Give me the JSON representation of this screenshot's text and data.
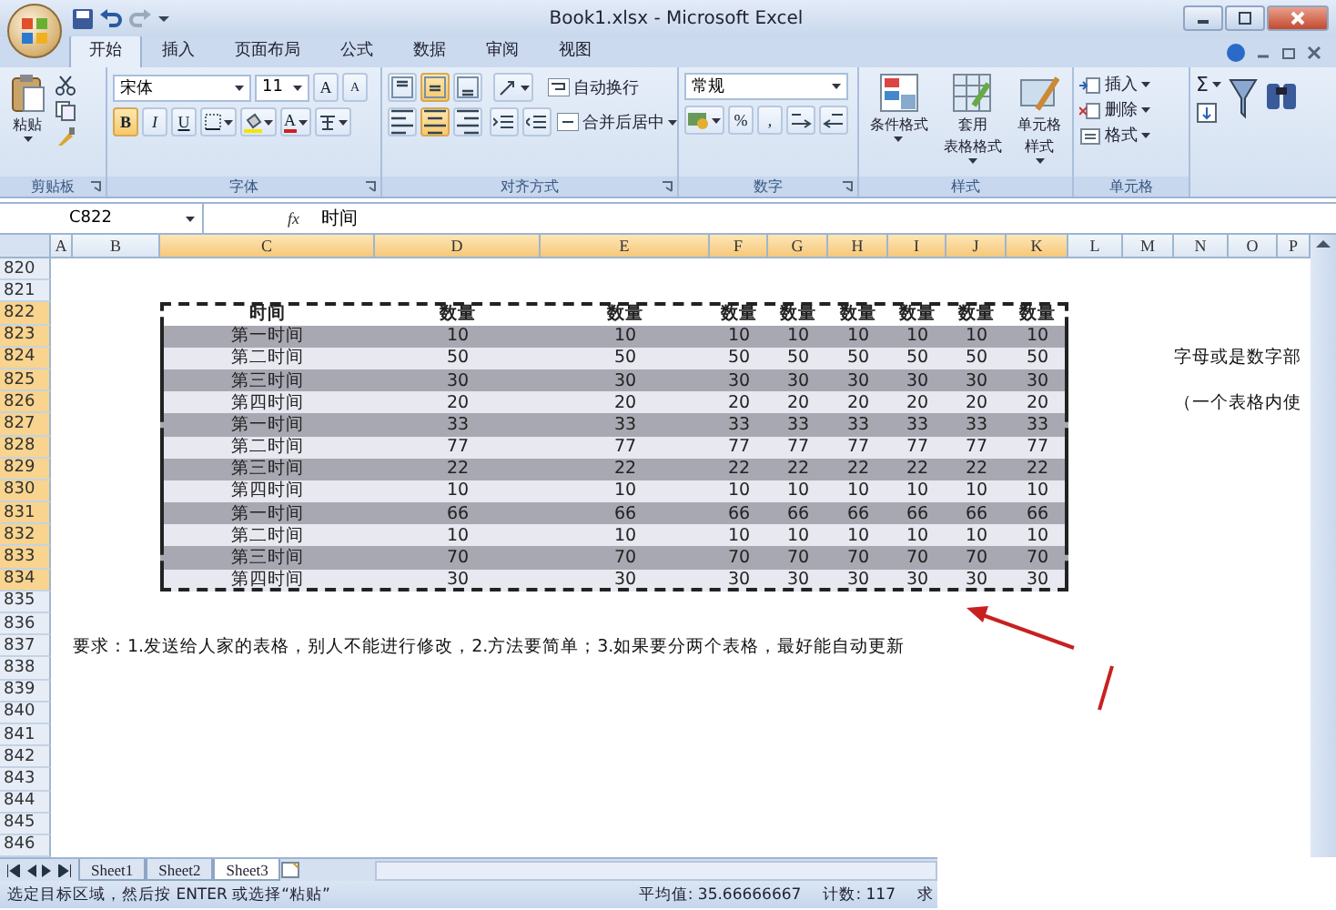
{
  "window": {
    "title": "Book1.xlsx - Microsoft Excel"
  },
  "tabs": [
    {
      "label": "开始",
      "selected": true
    },
    {
      "label": "插入",
      "selected": false
    },
    {
      "label": "页面布局",
      "selected": false
    },
    {
      "label": "公式",
      "selected": false
    },
    {
      "label": "数据",
      "selected": false
    },
    {
      "label": "审阅",
      "selected": false
    },
    {
      "label": "视图",
      "selected": false
    }
  ],
  "ribbon": {
    "clipboard": {
      "label": "剪贴板",
      "launcher": true,
      "paste": "粘贴"
    },
    "font": {
      "label": "字体",
      "launcher": true,
      "font_name": "宋体",
      "font_size": "11",
      "grow": "A",
      "shrink": "A",
      "styles": [
        {
          "label": "B",
          "selected": true
        },
        {
          "label": "I",
          "selected": false
        },
        {
          "label": "U",
          "selected": false
        }
      ],
      "font_color": "A"
    },
    "alignment": {
      "label": "对齐方式",
      "launcher": true,
      "vertical": [
        {
          "selected": false
        },
        {
          "selected": true
        },
        {
          "selected": false
        }
      ],
      "horizontal": [
        {
          "selected": false
        },
        {
          "selected": true
        },
        {
          "selected": false
        }
      ],
      "wrap": "自动换行",
      "merge": "合并后居中"
    },
    "number": {
      "label": "数字",
      "launcher": true,
      "format": "常规",
      "percent": "%",
      "comma": ","
    },
    "styles": {
      "label": "样式",
      "buttons": [
        {
          "kind": "conditional",
          "lines": [
            "条件格式"
          ]
        },
        {
          "kind": "table",
          "lines": [
            "套用",
            "表格格式"
          ]
        },
        {
          "kind": "cell",
          "lines": [
            "单元格",
            "样式"
          ]
        }
      ]
    },
    "cells": {
      "label": "单元格",
      "buttons": [
        {
          "kind": "insert",
          "label": "插入"
        },
        {
          "kind": "delete",
          "label": "删除"
        },
        {
          "kind": "format",
          "label": "格式"
        }
      ]
    },
    "editing": {
      "sum": "Σ"
    }
  },
  "formula_bar": {
    "name_box": "C822",
    "fx": "fx",
    "formula": "时间"
  },
  "sheet": {
    "columns": [
      {
        "label": "A",
        "selected": false
      },
      {
        "label": "B",
        "selected": false
      },
      {
        "label": "C",
        "selected": true
      },
      {
        "label": "D",
        "selected": true
      },
      {
        "label": "E",
        "selected": true
      },
      {
        "label": "F",
        "selected": true
      },
      {
        "label": "G",
        "selected": true
      },
      {
        "label": "H",
        "selected": true
      },
      {
        "label": "I",
        "selected": true
      },
      {
        "label": "J",
        "selected": true
      },
      {
        "label": "K",
        "selected": true
      },
      {
        "label": "L",
        "selected": false
      },
      {
        "label": "M",
        "selected": false
      },
      {
        "label": "N",
        "selected": false
      },
      {
        "label": "O",
        "selected": false
      },
      {
        "label": "P",
        "selected": false
      }
    ],
    "rows": [
      {
        "number": "820",
        "selected": false
      },
      {
        "number": "821",
        "selected": false
      },
      {
        "number": "822",
        "selected": true,
        "kind": "header",
        "cells": [
          "时间",
          "数量",
          "数量",
          "数量",
          "数量",
          "数量",
          "数量",
          "数量",
          "数量"
        ]
      },
      {
        "number": "823",
        "selected": true,
        "kind": "dark",
        "cells": [
          "第一时间",
          "10",
          "10",
          "10",
          "10",
          "10",
          "10",
          "10",
          "10"
        ]
      },
      {
        "number": "824",
        "selected": true,
        "kind": "light",
        "cells": [
          "第二时间",
          "50",
          "50",
          "50",
          "50",
          "50",
          "50",
          "50",
          "50"
        ],
        "side_note": "字母或是数字部"
      },
      {
        "number": "825",
        "selected": true,
        "kind": "dark",
        "cells": [
          "第三时间",
          "30",
          "30",
          "30",
          "30",
          "30",
          "30",
          "30",
          "30"
        ]
      },
      {
        "number": "826",
        "selected": true,
        "kind": "light",
        "cells": [
          "第四时间",
          "20",
          "20",
          "20",
          "20",
          "20",
          "20",
          "20",
          "20"
        ],
        "side_note": "（一个表格内使"
      },
      {
        "number": "827",
        "selected": true,
        "kind": "dark",
        "cells": [
          "第一时间",
          "33",
          "33",
          "33",
          "33",
          "33",
          "33",
          "33",
          "33"
        ]
      },
      {
        "number": "828",
        "selected": true,
        "kind": "light",
        "cells": [
          "第二时间",
          "77",
          "77",
          "77",
          "77",
          "77",
          "77",
          "77",
          "77"
        ]
      },
      {
        "number": "829",
        "selected": true,
        "kind": "dark",
        "cells": [
          "第三时间",
          "22",
          "22",
          "22",
          "22",
          "22",
          "22",
          "22",
          "22"
        ]
      },
      {
        "number": "830",
        "selected": true,
        "kind": "light",
        "cells": [
          "第四时间",
          "10",
          "10",
          "10",
          "10",
          "10",
          "10",
          "10",
          "10"
        ]
      },
      {
        "number": "831",
        "selected": true,
        "kind": "dark",
        "cells": [
          "第一时间",
          "66",
          "66",
          "66",
          "66",
          "66",
          "66",
          "66",
          "66"
        ]
      },
      {
        "number": "832",
        "selected": true,
        "kind": "light",
        "cells": [
          "第二时间",
          "10",
          "10",
          "10",
          "10",
          "10",
          "10",
          "10",
          "10"
        ]
      },
      {
        "number": "833",
        "selected": true,
        "kind": "dark",
        "cells": [
          "第三时间",
          "70",
          "70",
          "70",
          "70",
          "70",
          "70",
          "70",
          "70"
        ]
      },
      {
        "number": "834",
        "selected": true,
        "kind": "light",
        "cells": [
          "第四时间",
          "30",
          "30",
          "30",
          "30",
          "30",
          "30",
          "30",
          "30"
        ]
      },
      {
        "number": "835",
        "selected": false
      },
      {
        "number": "836",
        "selected": false
      },
      {
        "number": "837",
        "selected": false,
        "note": "要求：1.发送给人家的表格，别人不能进行修改，2.方法要简单；3.如果要分两个表格，最好能自动更新"
      },
      {
        "number": "838",
        "selected": false
      },
      {
        "number": "839",
        "selected": false
      },
      {
        "number": "840",
        "selected": false
      },
      {
        "number": "841",
        "selected": false
      },
      {
        "number": "842",
        "selected": false
      },
      {
        "number": "843",
        "selected": false
      },
      {
        "number": "844",
        "selected": false
      },
      {
        "number": "845",
        "selected": false
      },
      {
        "number": "846",
        "selected": false
      }
    ]
  },
  "sheet_tabs": [
    {
      "label": "Sheet1",
      "selected": false
    },
    {
      "label": "Sheet2",
      "selected": false
    },
    {
      "label": "Sheet3",
      "selected": true
    }
  ],
  "status_bar": {
    "message": "选定目标区域，然后按 ENTER 或选择“粘贴”",
    "average": "平均值: 35.66666667",
    "count": "计数: 117",
    "sum": "求"
  }
}
